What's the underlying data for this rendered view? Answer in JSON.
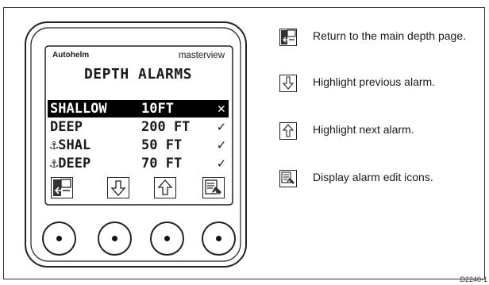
{
  "device": {
    "brand": "Autohelm",
    "model": "masterview",
    "screen_title": "DEPTH ALARMS",
    "alarms": [
      {
        "name": "SHALLOW",
        "value": "10FT",
        "status": "✕",
        "selected": true
      },
      {
        "name": "DEEP",
        "value": "200 FT",
        "status": "✓",
        "selected": false
      },
      {
        "name": "⚓SHAL",
        "value": "50 FT",
        "status": "✓",
        "selected": false
      },
      {
        "name": "⚓DEEP",
        "value": "70 FT",
        "status": "✓",
        "selected": false
      }
    ],
    "softkeys": [
      "return-page-icon",
      "arrow-down-icon",
      "arrow-up-icon",
      "edit-pen-icon"
    ]
  },
  "legend": [
    {
      "icon": "return-page-icon",
      "text": "Return to the main depth page."
    },
    {
      "icon": "arrow-down-icon",
      "text": "Highlight previous alarm."
    },
    {
      "icon": "arrow-up-icon",
      "text": "Highlight next alarm."
    },
    {
      "icon": "edit-pen-icon",
      "text": "Display alarm edit icons."
    }
  ],
  "figure_code": "D2240-1"
}
